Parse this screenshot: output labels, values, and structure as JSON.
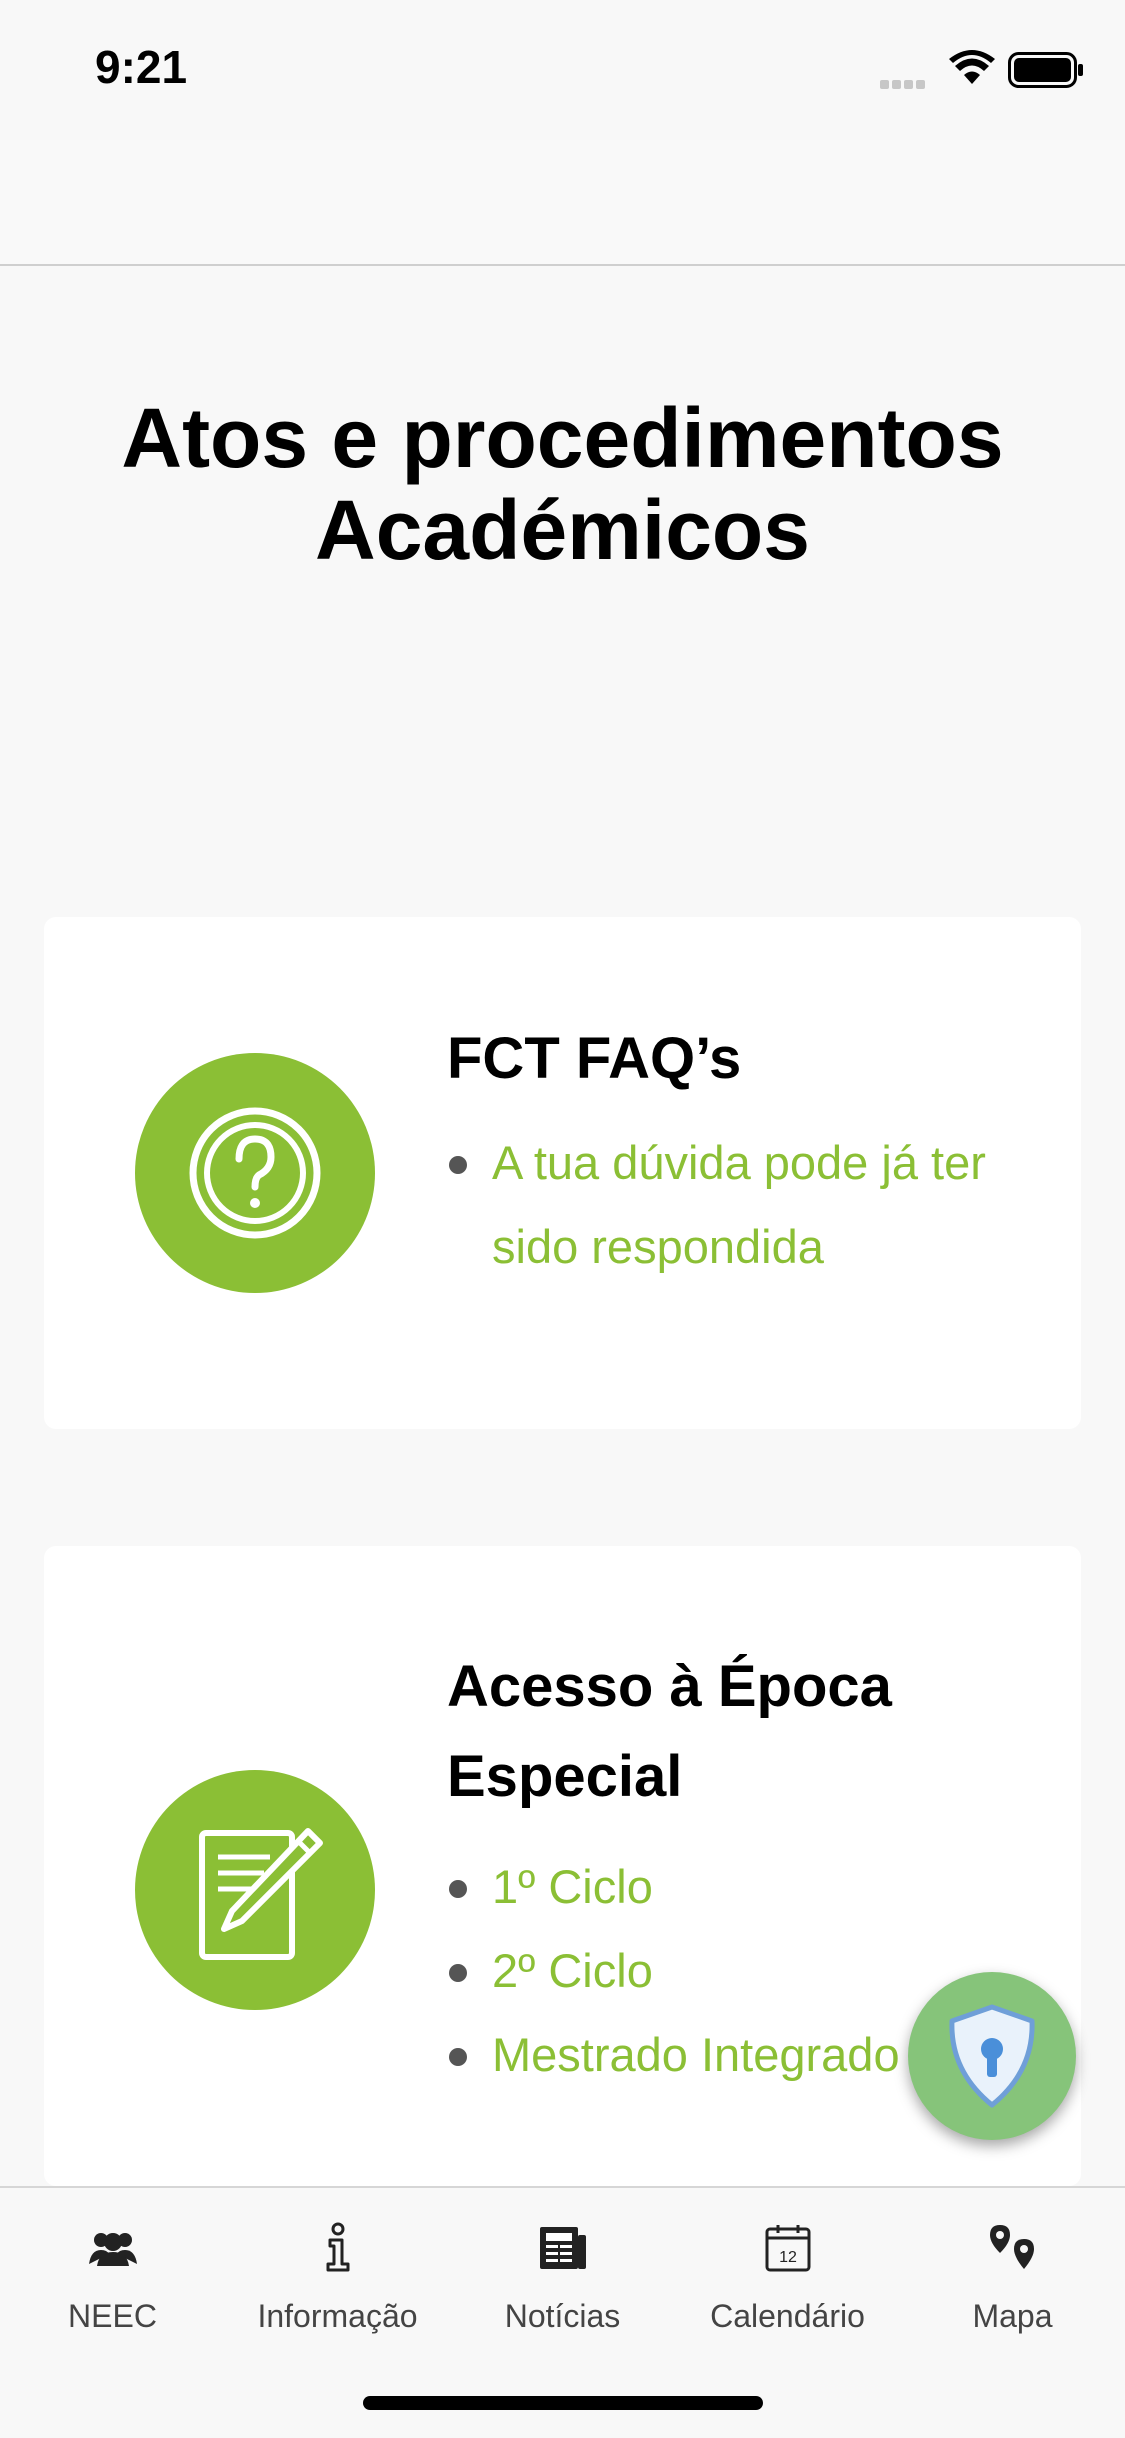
{
  "status_bar": {
    "time": "9:21"
  },
  "page": {
    "title": "Atos e procedimentos Académicos"
  },
  "cards": {
    "faq": {
      "title": "FCT FAQ’s",
      "icon": "question-circle-icon",
      "links": [
        "A tua dúvida pode já ter sido respondida"
      ]
    },
    "especial": {
      "title": "Acesso à Época Especial",
      "icon": "document-pencil-icon",
      "links": [
        "1º Ciclo",
        "2º Ciclo",
        "Mestrado Integrado"
      ]
    }
  },
  "fab": {
    "icon": "shield-lock-icon"
  },
  "tab_bar": {
    "items": [
      {
        "label": "NEEC",
        "icon": "group-icon"
      },
      {
        "label": "Informação",
        "icon": "info-icon"
      },
      {
        "label": "Notícias",
        "icon": "newspaper-icon"
      },
      {
        "label": "Calendário",
        "icon": "calendar-icon",
        "date": "12"
      },
      {
        "label": "Mapa",
        "icon": "map-pins-icon"
      }
    ]
  },
  "colors": {
    "accent": "#8bbf35",
    "fab": "#86c47a",
    "background": "#f8f8f8",
    "card": "#ffffff"
  }
}
